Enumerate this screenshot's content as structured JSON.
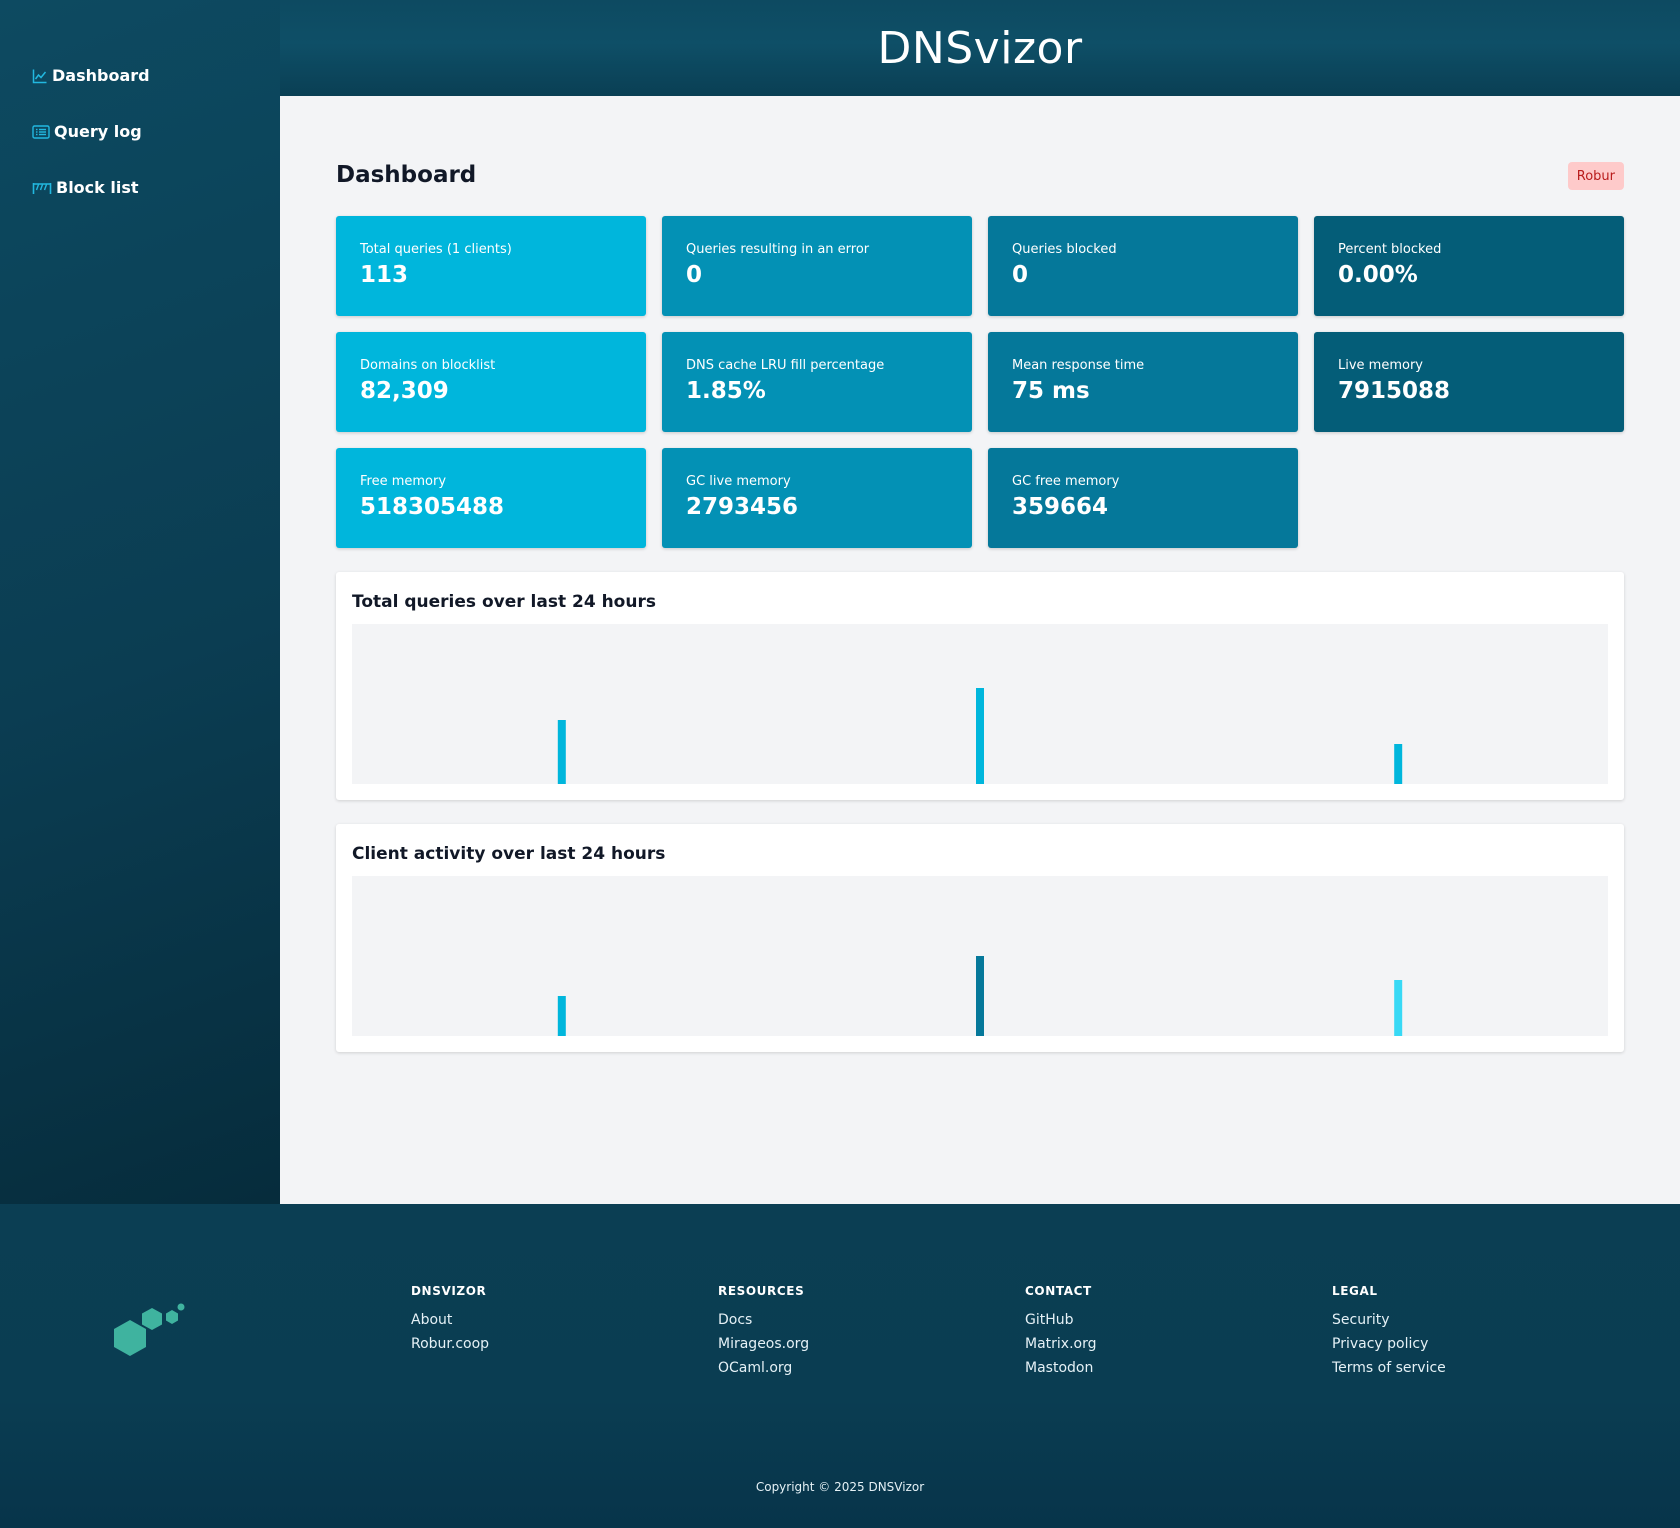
{
  "app": {
    "title": "DNSvizor"
  },
  "sidebar": {
    "items": [
      {
        "label": "Dashboard",
        "icon": "chart-line-icon"
      },
      {
        "label": "Query log",
        "icon": "list-icon"
      },
      {
        "label": "Block list",
        "icon": "fence-icon"
      }
    ]
  },
  "dashboard": {
    "title": "Dashboard",
    "badge": "Robur",
    "stats": [
      {
        "label": "Total queries (1 clients)",
        "value": "113"
      },
      {
        "label": "Queries resulting in an error",
        "value": "0"
      },
      {
        "label": "Queries blocked",
        "value": "0"
      },
      {
        "label": "Percent blocked",
        "value": "0.00%"
      },
      {
        "label": "Domains on blocklist",
        "value": "82,309"
      },
      {
        "label": "DNS cache LRU fill percentage",
        "value": "1.85%"
      },
      {
        "label": "Mean response time",
        "value": "75 ms"
      },
      {
        "label": "Live memory",
        "value": "7915088"
      },
      {
        "label": "Free memory",
        "value": "518305488"
      },
      {
        "label": "GC live memory",
        "value": "2793456"
      },
      {
        "label": "GC free memory",
        "value": "359664"
      }
    ],
    "charts": [
      {
        "title": "Total queries over last 24 hours"
      },
      {
        "title": "Client activity over last 24 hours"
      }
    ]
  },
  "chart_data": [
    {
      "type": "bar",
      "title": "Total queries over last 24 hours",
      "series": [
        {
          "color": "#00b6dc",
          "points": [
            {
              "pos": 0.167,
              "value": 40
            },
            {
              "pos": 0.5,
              "value": 60
            },
            {
              "pos": 0.833,
              "value": 25
            }
          ]
        }
      ],
      "ylim": [
        0,
        100
      ],
      "grid": false
    },
    {
      "type": "bar",
      "title": "Client activity over last 24 hours",
      "series": [
        {
          "color": "#00b6dc",
          "points": [
            {
              "pos": 0.167,
              "value": 25
            }
          ]
        },
        {
          "color": "#05789a",
          "points": [
            {
              "pos": 0.5,
              "value": 50
            }
          ]
        },
        {
          "color": "#38d9f5",
          "points": [
            {
              "pos": 0.833,
              "value": 35
            }
          ]
        }
      ],
      "ylim": [
        0,
        100
      ],
      "grid": false
    }
  ],
  "footer": {
    "columns": [
      {
        "heading": "DNSVIZOR",
        "links": [
          "About",
          "Robur.coop"
        ]
      },
      {
        "heading": "RESOURCES",
        "links": [
          "Docs",
          "Mirageos.org",
          "OCaml.org"
        ]
      },
      {
        "heading": "CONTACT",
        "links": [
          "GitHub",
          "Matrix.org",
          "Mastodon"
        ]
      },
      {
        "heading": "LEGAL",
        "links": [
          "Security",
          "Privacy policy",
          "Terms of service"
        ]
      }
    ],
    "copyright": "Copyright © 2025 DNSVizor"
  }
}
